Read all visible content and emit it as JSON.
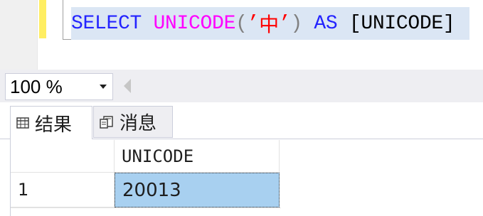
{
  "editor": {
    "tokens": {
      "select": "SELECT",
      "func": "UNICODE",
      "open_paren": "(",
      "quote_open": "’",
      "char": "中",
      "quote_close": "’",
      "close_paren": ")",
      "as": "AS",
      "alias": "[UNICODE]"
    },
    "colors": {
      "keyword": "#2323ff",
      "function": "#ff00ff",
      "string": "#ff0000",
      "selection": "#dbe6f4",
      "change_bar": "#ffee62"
    }
  },
  "zoom": {
    "value": "100 %",
    "arrow_icon": "chevron-down-icon"
  },
  "tabs": [
    {
      "label": "结果",
      "icon": "grid-icon"
    },
    {
      "label": "消息",
      "icon": "message-icon"
    }
  ],
  "results": {
    "columns": [
      "UNICODE"
    ],
    "rows": [
      {
        "num": "1",
        "values": [
          "20013"
        ]
      }
    ],
    "selected_cell_color": "#a8d0f0"
  }
}
